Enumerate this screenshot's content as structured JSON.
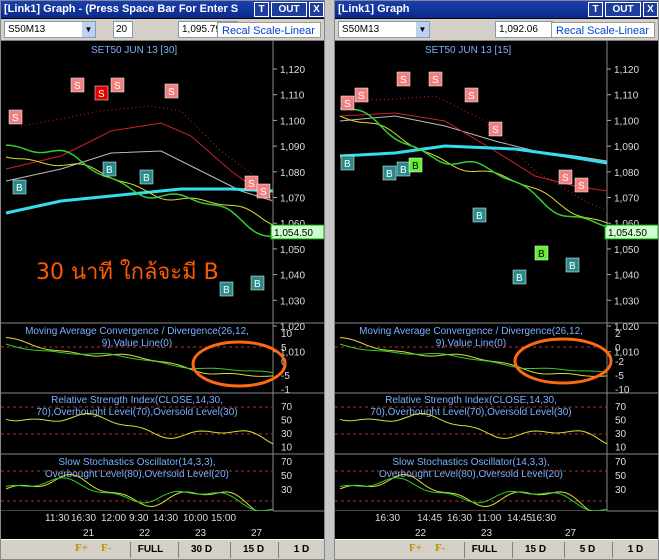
{
  "left": {
    "title": "[Link1] Graph  - (Press Space Bar For Enter S",
    "t_btn": "T",
    "out_btn": "OUT",
    "x_btn": "X",
    "symbol": "S50M13",
    "price_fragment": "20",
    "price": "1,095.79",
    "recal": "Recal Scale-Linear",
    "chart_title": "SET50 JUN 13   [30]",
    "last_price": "1,054.50",
    "annotation": "30 นาที ใกล้จะมี B",
    "price_ticks": [
      "1,120",
      "1,110",
      "1,100",
      "1,090",
      "1,080",
      "1,070",
      "1,060",
      "1,050",
      "1,040",
      "1,030",
      "1,020",
      "1,010"
    ],
    "macd_title": "Moving Average Convergence / Divergence(26,12,9),Value Line(0)",
    "macd_ticks": [
      "10",
      "5",
      "0",
      "-5",
      "-1"
    ],
    "rsi_title": "Relative Strength Index(CLOSE,14,30,70),Overbought Level(70),Oversold Level(30)",
    "rsi_ticks": [
      "70",
      "50",
      "30",
      "10"
    ],
    "sto_title": "Slow Stochastics Oscillator(14,3,3),Overbought Level(80),Oversold Level(20)",
    "sto_ticks": [
      "70",
      "50",
      "30"
    ],
    "times": [
      "11:30",
      "16:30",
      "12:00",
      "9:30",
      "14:30",
      "10:00",
      "15:00"
    ],
    "days": [
      "21",
      "22",
      "23",
      "27"
    ],
    "bottom_buttons": [
      "FULL",
      "30 D",
      "15 D",
      "1 D"
    ]
  },
  "right": {
    "title": "[Link1] Graph",
    "t_btn": "T",
    "out_btn": "OUT",
    "x_btn": "X",
    "symbol": "S50M13",
    "price": "1,092.06",
    "recal": "Recal Scale-Linear",
    "chart_title": "SET50 JUN 13   [15]",
    "last_price": "1,054.50",
    "price_ticks": [
      "1,120",
      "1,110",
      "1,100",
      "1,090",
      "1,080",
      "1,070",
      "1,060",
      "1,050",
      "1,040",
      "1,030",
      "1,020",
      "1,010"
    ],
    "macd_title": "Moving Average Convergence / Divergence(26,12,9),Value Line(0)",
    "macd_ticks": [
      "2",
      "0",
      "-2",
      "-5",
      "-10"
    ],
    "rsi_title": "Relative Strength Index(CLOSE,14,30,70),Overbought Level(70),Oversold Level(30)",
    "rsi_ticks": [
      "70",
      "50",
      "30",
      "10"
    ],
    "sto_title": "Slow Stochastics Oscillator(14,3,3),Overbought Level(80),Oversold Level(20)",
    "sto_ticks": [
      "70",
      "50",
      "30"
    ],
    "times": [
      "16:30",
      "14:45",
      "16:30",
      "11:00",
      "14:45",
      "16:30"
    ],
    "days": [
      "22",
      "23",
      "27"
    ],
    "bottom_buttons": [
      "FULL",
      "15 D",
      "5 D",
      "1 D"
    ]
  },
  "fplus": "F+",
  "fminus": "F-",
  "signal_s": "S",
  "signal_b": "B",
  "colors": {
    "signal_s": "#f08080",
    "signal_s_active": "#e00000",
    "signal_b": "#2a8a8a",
    "signal_b_active": "#66ee33",
    "ema_cyan": "#33ddee",
    "annotation": "#ff6a10",
    "titlebar": "#0a2a8a"
  }
}
